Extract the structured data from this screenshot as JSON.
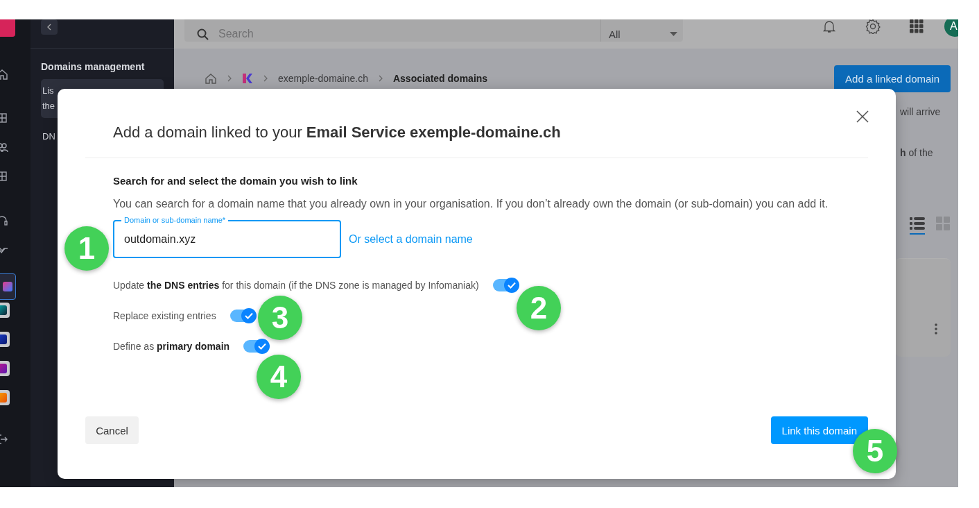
{
  "rail": {
    "apps": [
      {
        "selected": true
      },
      {
        "selected": false
      },
      {
        "selected": false
      },
      {
        "selected": false
      },
      {
        "selected": false
      }
    ]
  },
  "nav": {
    "section_title": "Domains management",
    "items": [
      {
        "lines": [
          "Lis",
          "the"
        ],
        "selected": true
      },
      {
        "lines": [
          "DN"
        ],
        "selected": false
      }
    ]
  },
  "topbar": {
    "search": {
      "placeholder": "Search"
    },
    "filter": "All",
    "avatar": "A"
  },
  "breadcrumb": [
    {
      "kind": "home"
    },
    {
      "kind": "logo"
    },
    {
      "kind": "link",
      "label": "exemple-domaine.ch"
    },
    {
      "kind": "current",
      "label": "Associated domains"
    }
  ],
  "page": {
    "add_button": "Add a linked domain",
    "text_1": "will arrive",
    "text_2": "**h** of the",
    "view": [
      {
        "kind": "list",
        "selected": true
      },
      {
        "kind": "grid",
        "selected": false
      }
    ]
  },
  "dialog": {
    "title": "Add a domain linked to your **Email Service exemple-domaine.ch**",
    "heading": "Search for and select the domain you wish to link",
    "description": "You can search for a domain name that you already own in your organisation. If you don’t already own the domain (or sub-domain) you can add it.",
    "field": {
      "label": "Domain or sub-domain name*",
      "value": "outdomain.xyz"
    },
    "select_link": "Or select a domain name",
    "options": [
      {
        "label": "Update **the DNS entries** for this domain (if the DNS zone is managed by Infomaniak)",
        "on": true
      },
      {
        "label": "Replace existing entries",
        "on": true
      },
      {
        "label": "Define as **primary domain**",
        "on": true
      }
    ],
    "cancel": "Cancel",
    "submit": "Link this domain"
  },
  "markers": [
    "1",
    "2",
    "3",
    "4",
    "5"
  ]
}
